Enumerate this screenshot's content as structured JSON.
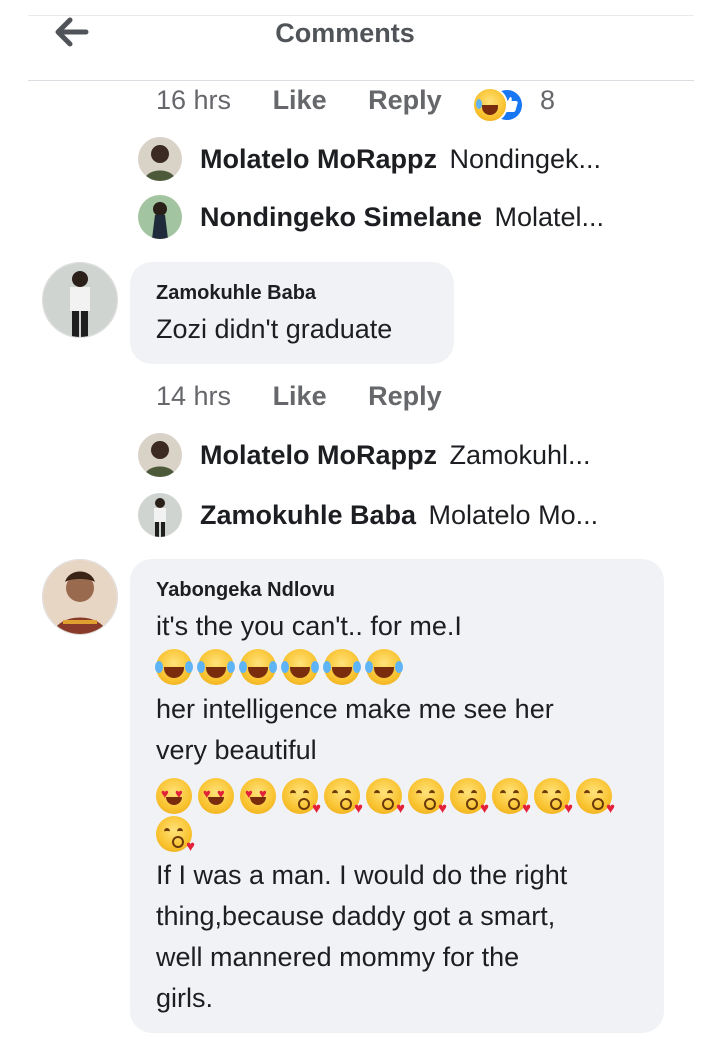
{
  "header": {
    "title": "Comments"
  },
  "thread1": {
    "meta": {
      "time": "16 hrs",
      "like": "Like",
      "reply": "Reply",
      "reaction_count": "8"
    },
    "replies": [
      {
        "name": "Molatelo MoRappz",
        "snippet": "Nondingek..."
      },
      {
        "name": "Nondingeko Simelane",
        "snippet": "Molatel..."
      }
    ]
  },
  "comment2": {
    "author": "Zamokuhle Baba",
    "text": "Zozi didn't graduate",
    "meta": {
      "time": "14 hrs",
      "like": "Like",
      "reply": "Reply"
    },
    "replies": [
      {
        "name": "Molatelo MoRappz",
        "snippet": "Zamokuhl..."
      },
      {
        "name": "Zamokuhle Baba",
        "snippet": "Molatelo Mo..."
      }
    ]
  },
  "comment3": {
    "author": "Yabongeka Ndlovu",
    "line1": "it's the you can't..  for me.I",
    "line2": "her intelligence make me see her",
    "line3": "very beautiful",
    "line4": "If I was a man.  I would do the right",
    "line5": "thing,because daddy got a smart,",
    "line6": "well mannered mommy for the",
    "line7": "girls.",
    "emoji_row1": [
      "laughing-tears",
      "laughing-tears",
      "laughing-tears",
      "laughing-tears",
      "laughing-tears",
      "laughing-tears"
    ],
    "emoji_row2": [
      "heart-eyes",
      "heart-eyes",
      "heart-eyes",
      "kissing-face",
      "kissing-face",
      "kissing-face",
      "kissing-face",
      "kissing-face",
      "kissing-face",
      "kissing-face",
      "kissing-face"
    ],
    "emoji_row3": [
      "kissing-face"
    ]
  },
  "colors": {
    "bubble": "#f0f2f5",
    "meta_gray": "#65676b",
    "reaction_blue": "#1877f2",
    "reaction_yellow": "#f9c22e"
  }
}
